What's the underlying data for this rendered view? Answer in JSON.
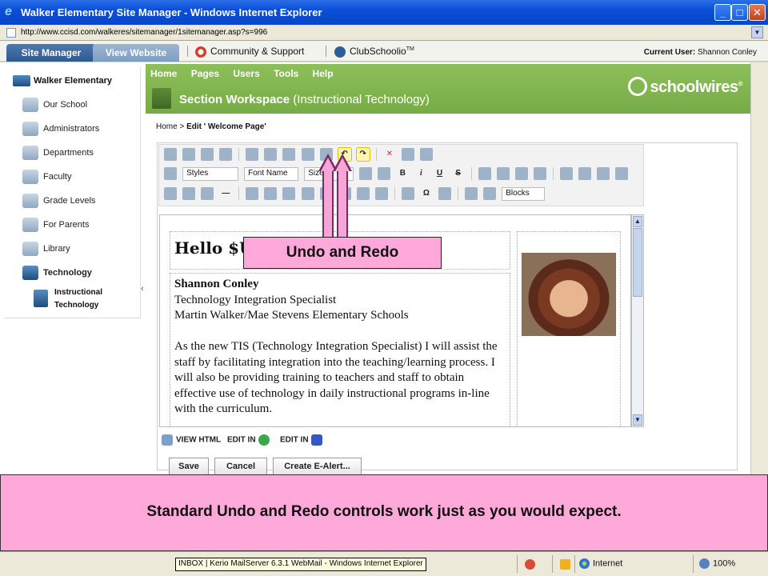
{
  "window": {
    "title": "Walker Elementary Site Manager - Windows Internet Explorer",
    "buttons": [
      "_",
      "□",
      "✕"
    ]
  },
  "address": {
    "url": "http://www.ccisd.com/walkeres/sitemanager/1sitemanager.asp?s=996"
  },
  "topnav": {
    "tab_site_manager": "Site Manager",
    "tab_view_website": "View Website",
    "community_support": "Community & Support",
    "clubschoolio": "ClubSchoolio",
    "clubschoolio_tm": "TM",
    "current_user_label": "Current User:",
    "current_user_name": "Shannon Conley"
  },
  "sidebar": {
    "head": "Walker Elementary",
    "items": [
      {
        "label": "Our School"
      },
      {
        "label": "Administrators"
      },
      {
        "label": "Departments"
      },
      {
        "label": "Faculty"
      },
      {
        "label": "Grade Levels"
      },
      {
        "label": "For Parents"
      },
      {
        "label": "Library"
      },
      {
        "label": "Technology"
      }
    ],
    "sub": "Instructional Technology",
    "collapse_glyph": "‹"
  },
  "header": {
    "menu": [
      "Home",
      "Pages",
      "Users",
      "Tools",
      "Help"
    ],
    "workspace_title": "Section Workspace",
    "workspace_section": "(Instructional Technology)",
    "logo": "schoolwires",
    "logo_mark": "®"
  },
  "breadcrumb": {
    "home": "Home",
    "separator": ">",
    "current": "Edit ' Welcome Page'"
  },
  "toolbar": {
    "styles": "Styles",
    "font_name": "Font Name",
    "size": "Size",
    "blocks": "Blocks",
    "bold": "B",
    "italic": "i",
    "underline": "U",
    "strike": "S",
    "omega": "Ω"
  },
  "document": {
    "heading": "Hello $U",
    "name": "Shannon Conley",
    "role": "Technology Integration Specialist",
    "schools": "Martin Walker/Mae Stevens Elementary Schools",
    "paragraph": "As the new TIS (Technology Integration Specialist) I will assist the staff by facilitating integration into the teaching/learning process. I will also be providing training to teachers and staff to obtain effective use of technology in daily instructional programs in-line with the curriculum."
  },
  "modes": {
    "view_html": "VIEW HTML",
    "edit_in_1": "EDIT IN",
    "edit_in_2": "EDIT IN"
  },
  "buttons": {
    "save": "Save",
    "cancel": "Cancel",
    "create_alert": "Create E-Alert..."
  },
  "callout": {
    "label": "Undo and Redo"
  },
  "caption": {
    "text": "Standard Undo and Redo controls work just as you would expect."
  },
  "status": {
    "tooltip": "INBOX | Kerio MailServer 6.3.1 WebMail - Windows Internet Explorer",
    "zone": "Internet",
    "zoom": "100%"
  },
  "colors": {
    "header_green": "#7fb24d",
    "callout_pink": "#ffa8d9",
    "titlebar_blue": "#0a4fd8"
  }
}
